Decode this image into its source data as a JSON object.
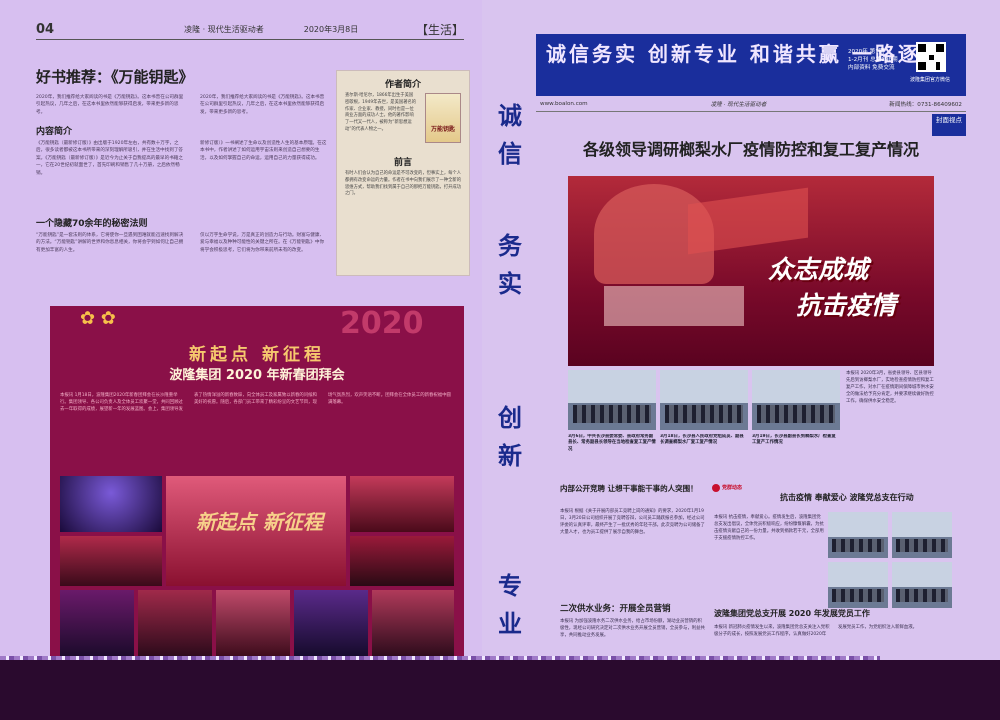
{
  "left": {
    "page_number": "04",
    "running_head_paper": "凌隆 · 现代生活驱动者",
    "running_head_date": "2020年3月8日",
    "section": "【生活】",
    "book_title": "好书推荐：《万能钥匙》",
    "intro": "2020年，我们推荐给大家阅读的书是《万能钥匙》。这本书曾在公司群里引起热议，几年之后，在这本书里依然能够获得启发，带来更多新的思考。",
    "sub_content": "内容简介",
    "content_text": "《万能钥匙（最新修订版）》由出版于1920年左右，共有数十万字，之后，很多读者都被这本书所带来的深刻理解所吸引，并在生活中找到了答案。《万能钥匙（最新修订版）》是近今为止关于自我提高的最早的书籍之一，它在20世纪初就面世了，首先印刷和销售了几十万册，之后依然畅销。",
    "sub_secret": "一个隐藏70余年的秘密法则",
    "secret_text": "“万能钥匙”是一套法则的体系，它将使你一旦遇到困难就能迅速找到解决的方法。“万能钥匙”讲解的世界和你息息相关，你将会学到如何让自己拥有更加丰富的人生。",
    "mid_col_text": "新修订版）》一书阐述了生命以及创造性人生的基本原理。在这本书中，作者讲述了如何运用宇宙法则来创造自己想要的生活，以及如何掌握自己的命运，运用自己的力量获得成功。",
    "mid_col_text2": "仅以万字生命学说，万是真正的创造力与行动。财富与健康、爱与幸福以及种种可能性的关键之所在。在《万能钥匙》中你将学会积极思考，它们将为你带来前所未有的改变。"
  },
  "author_box": {
    "heading": "作者简介",
    "bio": "查尔斯·哈尼尔，1866年出生于美国密歇根，1949年去世，是美国著名的作家、企业家、教授，同时也是一位商业方面的成功人士。他的著作影响了一代又一代人，被称为“新思想运动”的代表人物之一。",
    "cover_text": "万能钥匙",
    "preface_heading": "前言",
    "preface": "有时人们会认为自己的命运是不可改变的，但事实上，每个人都拥有改变命运的力量。作者在书中向我们展示了一种全新的思维方式，帮助我们找到属于自己的那把万能钥匙，打开成功之门。"
  },
  "newyear": {
    "deco": "2020",
    "title": "新起点 新征程",
    "subtitle": "波隆集团 2020 年新春团拜会",
    "body": "本报讯 1月18日，波隆集团2020年新春团拜会在长沙隆重举行。集团领导、各公司负责人及全体员工欢聚一堂，共同回顾过去一年取得的成绩，展望新一年的发展蓝图。会上，集团领导发表了热情洋溢的新春致辞，向全体员工及家属致以新春的问候和美好的祝愿。随后，各部门员工带来了精彩纷呈的文艺节目，现场气氛热烈，欢声笑语不断。团拜会在全体员工的新春祝福中圆满落幕。",
    "stage_text": "新起点 新征程"
  },
  "slogans": [
    "诚",
    "信",
    "务",
    "实",
    "创",
    "新",
    "专",
    "业"
  ],
  "right": {
    "masthead_text": "诚信务实 创新专业 和谐共赢 一路逐浪",
    "issue_info": "2020年 第1期\n1-2月刊 总第196期\n内部资料 免费交流",
    "qr_caption": "波隆集团官方微信",
    "website": "www.boalon.com",
    "paper_name": "凌隆 · 现代生活驱动者",
    "hotline": "新闻热线：0731-86409602",
    "tag": "封面视点",
    "headline": "各级领导调研榔梨水厂疫情防控和复工复产情况",
    "hero_line1": "众志成城",
    "hero_line2": "抗击疫情",
    "hero_body": "本报讯 2020年3月，省委县领导、区县领导先后到访榔梨水厂，实地检查疫情防控和复工复产工作，对水厂在疫情期间保障城市供水安全的做法给予充分肯定，并要求继续做好防控工作，确保供水安全稳定。",
    "captions": [
      "3月6日，中共长沙县委常委、县政府常务副县长、常务副县长领导在当地检查复工复产情况",
      "3月18日，长沙县人民政府党组成员、副县长调查榔梨水厂复工复产情况",
      "3月19日，长沙县副县长到榔梨水厂检查复工复产工作情况"
    ],
    "sub1": "内部公开竞聘 让想干事能干事的人突围！",
    "sub1_body": "本报讯 根据《关于开展内部员工竞聘上岗的通知》的要求，2020年1月19日，3月20日公司组织开展了竞聘答辩，公司员工踊跃报名参加，经过公司评委的认真评审，最终产生了一批优秀的年轻干部。此次竞聘为公司储备了大量人才，也为员工提供了展示自我的舞台。",
    "sub2": "二次供水业务：开展全员营销",
    "sub2_body": "本报讯 为加强波隆水务二次供水业务，给占市场份额，湖动业员营销的积极性，现经公司研究决定对二次供水业务开展全员营销，全员参与，利益共享，共同推动业务发展。",
    "party_label": "党群动态",
    "sub3": "抗击疫情 奉献爱心 波隆党总支在行动",
    "sub3_body": "本报讯 抗击疫情，奉献爱心。疫情发生后，波隆集团党总支发出倡议，全体党员积极响应，纷纷慷慨解囊，为抗击疫情贡献自己的一份力量。共收到捐款若干元，全部用于支援疫情防控工作。",
    "sub4": "波隆集团党总支开展 2020 年发展党员工作",
    "sub4_body": "本报讯 新冠肺炎疫情发生以来，波隆集团党总支关注入党积极分子的成长，按照发展党员工作程序，认真做好2020年发展党员工作，为党组织注入新鲜血液。"
  }
}
